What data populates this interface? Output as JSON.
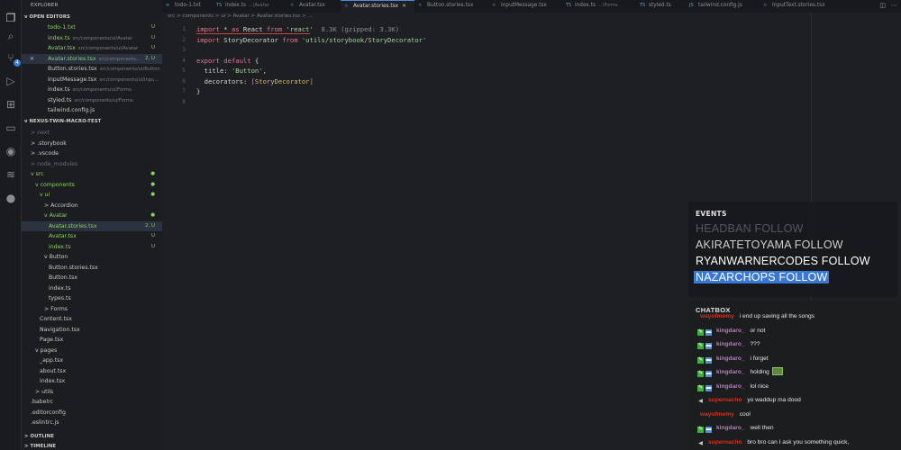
{
  "explorer": {
    "title": "EXPLORER",
    "open_editors_label": "OPEN EDITORS",
    "open_editors": [
      {
        "name": "todo-1.txt",
        "path": "",
        "badge": "U",
        "cls": "green"
      },
      {
        "name": "index.ts",
        "path": "src/components/ui/Avatar",
        "badge": "U",
        "cls": "green"
      },
      {
        "name": "Avatar.tsx",
        "path": "src/components/ui/Avatar",
        "badge": "U",
        "cls": "green"
      },
      {
        "name": "Avatar.stories.tsx",
        "path": "src/components...",
        "badge": "2, U",
        "cls": "green"
      },
      {
        "name": "Button.stories.tsx",
        "path": "src/components/ui/Button",
        "badge": "",
        "cls": ""
      },
      {
        "name": "InputMessage.tsx",
        "path": "src/components/ui/Inpu...",
        "badge": "",
        "cls": ""
      },
      {
        "name": "index.ts",
        "path": "src/components/ui/Forms",
        "badge": "",
        "cls": ""
      },
      {
        "name": "styled.ts",
        "path": "src/components/ui/Forms",
        "badge": "",
        "cls": ""
      },
      {
        "name": "tailwind.config.js",
        "path": "",
        "badge": "",
        "cls": ""
      }
    ],
    "project_label": "NEXUS-TWIN-MACRO-TEST",
    "tree": [
      {
        "name": "next",
        "badge": "",
        "cls": "dim",
        "indent": 0,
        "chev": ">"
      },
      {
        "name": ".storybook",
        "badge": "",
        "cls": "",
        "indent": 0,
        "chev": ">"
      },
      {
        "name": ".vscode",
        "badge": "",
        "cls": "",
        "indent": 0,
        "chev": ">"
      },
      {
        "name": "node_modules",
        "badge": "",
        "cls": "dim",
        "indent": 0,
        "chev": ">"
      },
      {
        "name": "src",
        "badge": "●",
        "cls": "green",
        "indent": 0,
        "chev": "v"
      },
      {
        "name": "components",
        "badge": "●",
        "cls": "green",
        "indent": 1,
        "chev": "v"
      },
      {
        "name": "ui",
        "badge": "●",
        "cls": "green",
        "indent": 2,
        "chev": "v"
      },
      {
        "name": "Accordion",
        "badge": "",
        "cls": "",
        "indent": 3,
        "chev": ">"
      },
      {
        "name": "Avatar",
        "badge": "●",
        "cls": "green",
        "indent": 3,
        "chev": "v"
      },
      {
        "name": "Avatar.stories.tsx",
        "badge": "2, U",
        "cls": "green",
        "indent": 4,
        "chev": ""
      },
      {
        "name": "Avatar.tsx",
        "badge": "U",
        "cls": "green",
        "indent": 4,
        "chev": ""
      },
      {
        "name": "index.ts",
        "badge": "U",
        "cls": "green",
        "indent": 4,
        "chev": ""
      },
      {
        "name": "Button",
        "badge": "",
        "cls": "",
        "indent": 3,
        "chev": "v"
      },
      {
        "name": "Button.stories.tsx",
        "badge": "",
        "cls": "",
        "indent": 4,
        "chev": ""
      },
      {
        "name": "Button.tsx",
        "badge": "",
        "cls": "",
        "indent": 4,
        "chev": ""
      },
      {
        "name": "index.ts",
        "badge": "",
        "cls": "",
        "indent": 4,
        "chev": ""
      },
      {
        "name": "types.ts",
        "badge": "",
        "cls": "",
        "indent": 4,
        "chev": ""
      },
      {
        "name": "Forms",
        "badge": "",
        "cls": "",
        "indent": 3,
        "chev": ">"
      },
      {
        "name": "Content.tsx",
        "badge": "",
        "cls": "",
        "indent": 2,
        "chev": ""
      },
      {
        "name": "Navigation.tsx",
        "badge": "",
        "cls": "",
        "indent": 2,
        "chev": ""
      },
      {
        "name": "Page.tsx",
        "badge": "",
        "cls": "",
        "indent": 2,
        "chev": ""
      },
      {
        "name": "pages",
        "badge": "",
        "cls": "",
        "indent": 1,
        "chev": "v"
      },
      {
        "name": "_app.tsx",
        "badge": "",
        "cls": "",
        "indent": 2,
        "chev": ""
      },
      {
        "name": "about.tsx",
        "badge": "",
        "cls": "",
        "indent": 2,
        "chev": ""
      },
      {
        "name": "index.tsx",
        "badge": "",
        "cls": "",
        "indent": 2,
        "chev": ""
      },
      {
        "name": "utils",
        "badge": "",
        "cls": "",
        "indent": 1,
        "chev": ">"
      },
      {
        "name": ".babelrc",
        "badge": "",
        "cls": "",
        "indent": 0,
        "chev": ""
      },
      {
        "name": ".editorconfig",
        "badge": "",
        "cls": "",
        "indent": 0,
        "chev": ""
      },
      {
        "name": ".eslintrc.js",
        "badge": "",
        "cls": "",
        "indent": 0,
        "chev": ""
      }
    ],
    "outline_label": "OUTLINE",
    "timeline_label": "TIMELINE"
  },
  "tabs": [
    {
      "label": "todo-1.txt",
      "path": "",
      "icon": "≡",
      "active": false
    },
    {
      "label": "index.ts",
      "path": "...\\Avatar",
      "icon": "TS",
      "active": false
    },
    {
      "label": "Avatar.tsx",
      "path": "",
      "icon": "⚛",
      "active": false
    },
    {
      "label": "Avatar.stories.tsx",
      "path": "",
      "icon": "⚛",
      "active": true
    },
    {
      "label": "Button.stories.tsx",
      "path": "",
      "icon": "⚛",
      "active": false
    },
    {
      "label": "InputMessage.tsx",
      "path": "",
      "icon": "⚛",
      "active": false
    },
    {
      "label": "index.ts",
      "path": "...\\Forms",
      "icon": "TS",
      "active": false
    },
    {
      "label": "styled.ts",
      "path": "",
      "icon": "TS",
      "active": false
    },
    {
      "label": "tailwind.config.js",
      "path": "",
      "icon": "JS",
      "active": false
    },
    {
      "label": "InputText.stories.tsx",
      "path": "",
      "icon": "⚛",
      "active": false
    }
  ],
  "breadcrumb": "src > components > ui > Avatar > Avatar.stories.tsx > ...",
  "code": {
    "line_numbers": [
      "1",
      "2",
      "3",
      "4",
      "5",
      "6",
      "7",
      "8"
    ],
    "import_size_hint": "8.3K (gzipped: 3.3K)"
  },
  "events": {
    "title": "EVENTS",
    "items": [
      {
        "text": "HEADBAN  FOLLOW",
        "style": "faded"
      },
      {
        "text": "AKIRATETOYAMA  FOLLOW",
        "style": "mid"
      },
      {
        "text": "RYANWARNERCODES  FOLLOW",
        "style": "bright"
      },
      {
        "text": "NAZARCHOPS  FOLLOW",
        "style": "hl"
      }
    ]
  },
  "chatbox": {
    "title": "CHATBOX",
    "messages": [
      {
        "user": "wayofmemy",
        "text": "i end up saving all the songs",
        "badges": "none",
        "color": "red"
      },
      {
        "user": "kingdaro_",
        "text": "or not",
        "badges": "mod-sub",
        "color": "pink"
      },
      {
        "user": "kingdaro_",
        "text": "???",
        "badges": "mod-sub",
        "color": "pink"
      },
      {
        "user": "kingdaro_",
        "text": "i forget",
        "badges": "mod-sub",
        "color": "pink"
      },
      {
        "user": "kingdaro_",
        "text": "holding",
        "badges": "mod-sub",
        "color": "pink",
        "emote": true
      },
      {
        "user": "kingdaro_",
        "text": "lol nice",
        "badges": "mod-sub",
        "color": "pink"
      },
      {
        "user": "supernacho",
        "text": "yo waddup ma dood",
        "badges": "sound",
        "color": "red"
      },
      {
        "user": "wayofmemy",
        "text": "cool",
        "badges": "none",
        "color": "red"
      },
      {
        "user": "kingdaro_",
        "text": "well then",
        "badges": "mod-sub",
        "color": "pink"
      },
      {
        "user": "supernacho",
        "text": "bro bro can I ask you something quick,",
        "badges": "sound",
        "color": "red"
      }
    ]
  }
}
